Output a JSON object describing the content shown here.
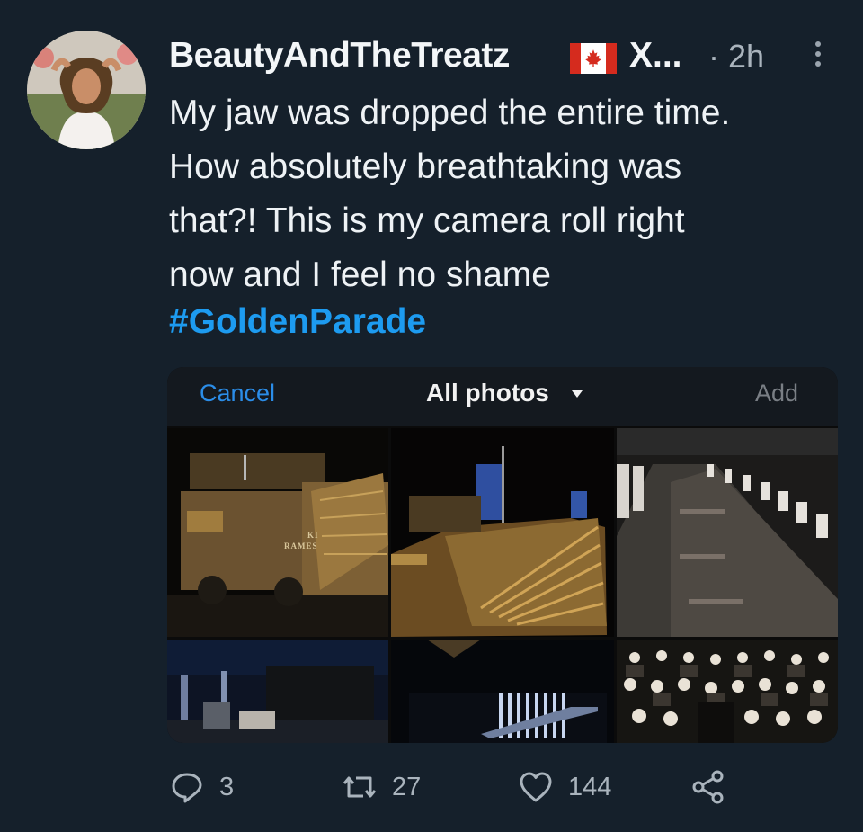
{
  "author": {
    "name": "BeautyAndTheTreatz",
    "flag": "canada-flag",
    "handle": "X...",
    "time": "· 2h"
  },
  "tweet": {
    "text": "My jaw was dropped the entire time.\nHow absolutely breathtaking was\nthat?! This is my camera roll right\nnow and I feel no shame",
    "hashtag": "#GoldenParade"
  },
  "picker": {
    "cancel_label": "Cancel",
    "title": "All photos",
    "add_label": "Add",
    "thumb_captions": [
      "KI",
      "RAMES"
    ]
  },
  "actions": {
    "replies": "3",
    "retweets": "27",
    "likes": "144"
  },
  "colors": {
    "background": "#15202b",
    "accent": "#1d9bf0",
    "muted": "#aab4bd"
  }
}
